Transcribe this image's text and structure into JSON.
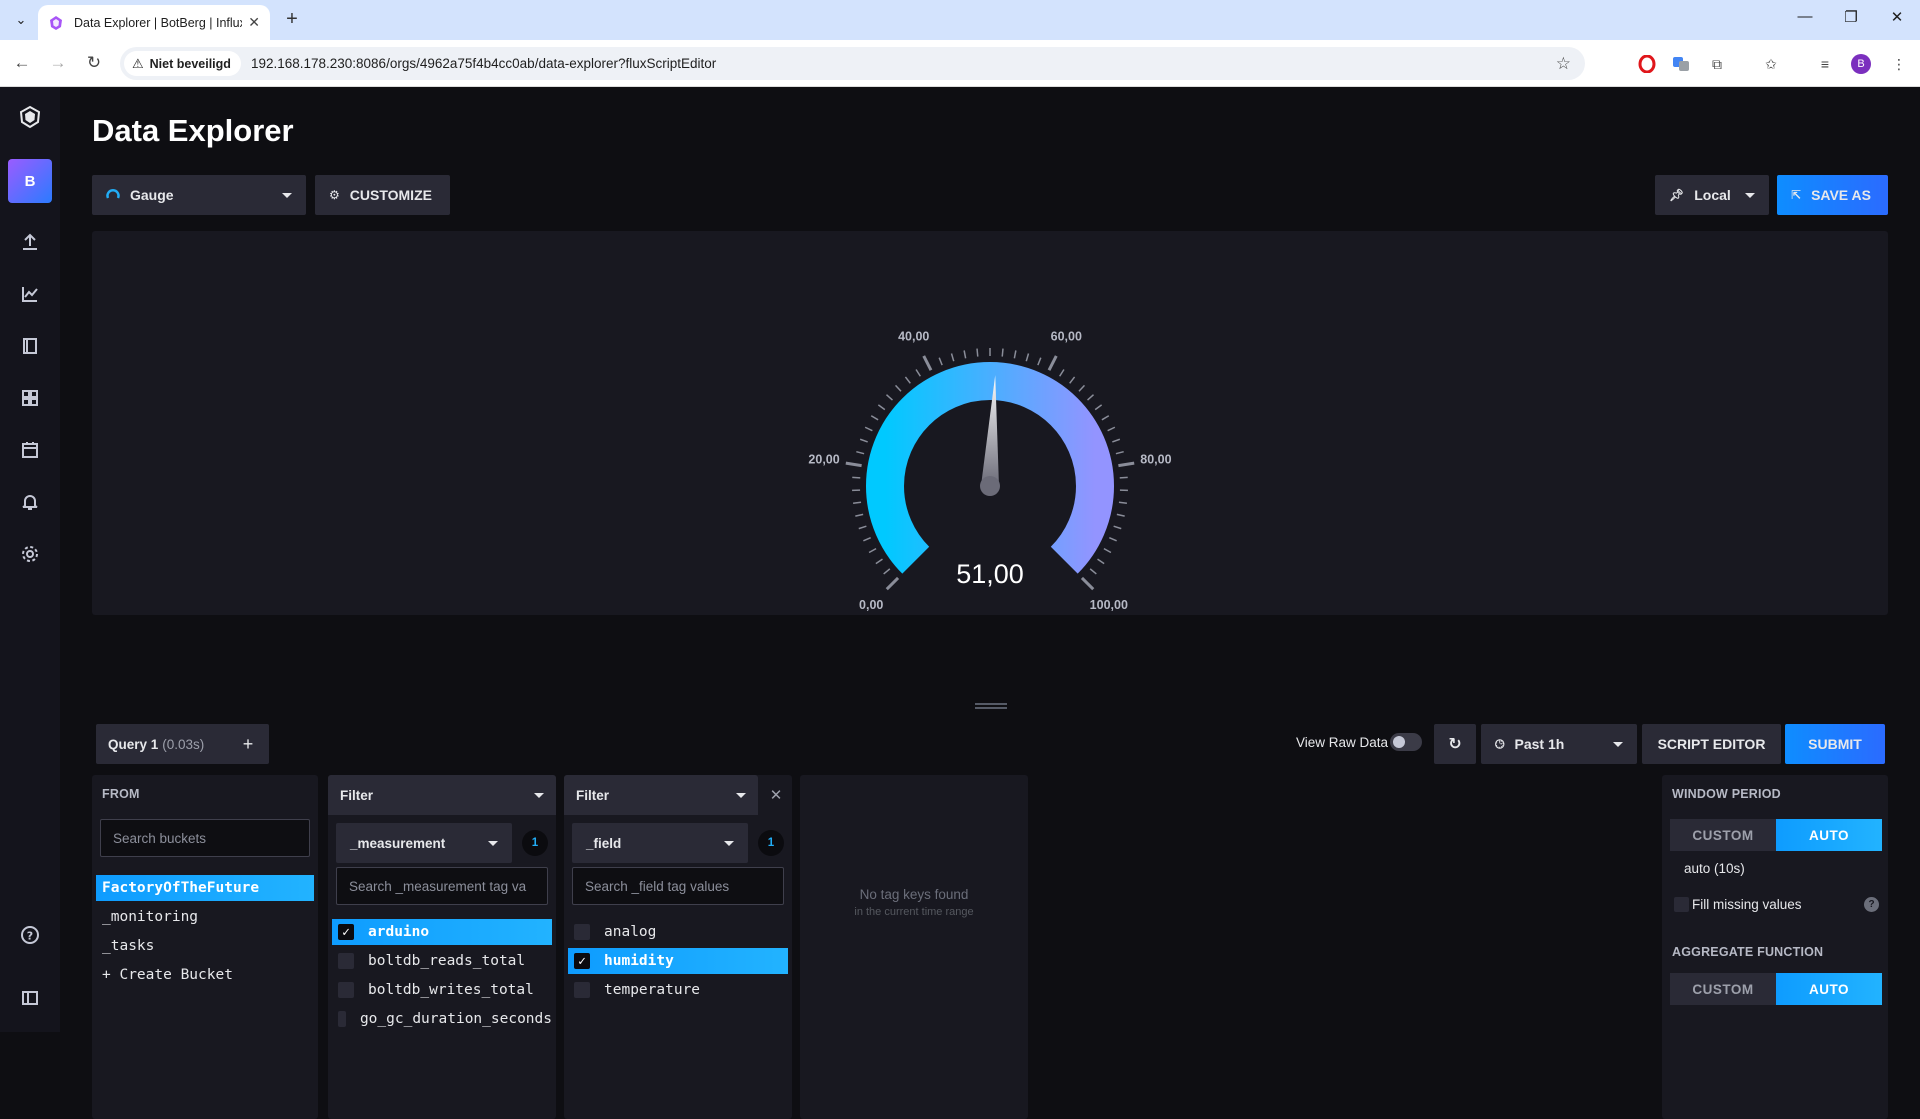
{
  "browser": {
    "tab_title": "Data Explorer | BotBerg | InfluxDB",
    "security_label": "Niet beveiligd",
    "url": "192.168.178.230:8086/orgs/4962a75f4b4cc0ab/data-explorer?fluxScriptEditor",
    "profile_initial": "B"
  },
  "sidebar": {
    "org_initial": "B"
  },
  "page": {
    "title": "Data Explorer",
    "viz_type": "Gauge",
    "customize_label": "CUSTOMIZE",
    "timezone_label": "Local",
    "save_as_label": "SAVE AS"
  },
  "gauge": {
    "value": 51,
    "value_label": "51,00",
    "min": 0,
    "max": 100,
    "tick_labels": [
      "0,00",
      "20,00",
      "40,00",
      "60,00",
      "80,00",
      "100,00"
    ],
    "gradient_start": "#00c9ff",
    "gradient_end": "#9394ff"
  },
  "query_bar": {
    "query_tab_label": "Query 1",
    "query_time": "(0.03s)",
    "add_label": "+",
    "view_raw_label": "View Raw Data",
    "time_range_label": "Past 1h",
    "script_editor_label": "SCRIPT EDITOR",
    "submit_label": "SUBMIT"
  },
  "from_panel": {
    "label": "FROM",
    "search_placeholder": "Search buckets",
    "buckets": [
      "FactoryOfTheFuture",
      "_monitoring",
      "_tasks",
      "+ Create Bucket"
    ],
    "selected": "FactoryOfTheFuture"
  },
  "filter1": {
    "label": "Filter",
    "key": "_measurement",
    "count": "1",
    "search_placeholder": "Search _measurement tag va",
    "items": [
      {
        "label": "arduino",
        "checked": true
      },
      {
        "label": "boltdb_reads_total",
        "checked": false
      },
      {
        "label": "boltdb_writes_total",
        "checked": false
      },
      {
        "label": "go_gc_duration_seconds",
        "checked": false
      }
    ]
  },
  "filter2": {
    "label": "Filter",
    "key": "_field",
    "count": "1",
    "search_placeholder": "Search _field tag values",
    "items": [
      {
        "label": "analog",
        "checked": false
      },
      {
        "label": "humidity",
        "checked": true
      },
      {
        "label": "temperature",
        "checked": false
      }
    ]
  },
  "empty_panel": {
    "title": "No tag keys found",
    "subtitle": "in the current time range"
  },
  "window_panel": {
    "window_period_label": "WINDOW PERIOD",
    "custom_label": "CUSTOM",
    "auto_label": "AUTO",
    "auto_value": "auto (10s)",
    "fill_missing_label": "Fill missing values",
    "aggregate_label": "AGGREGATE FUNCTION"
  }
}
